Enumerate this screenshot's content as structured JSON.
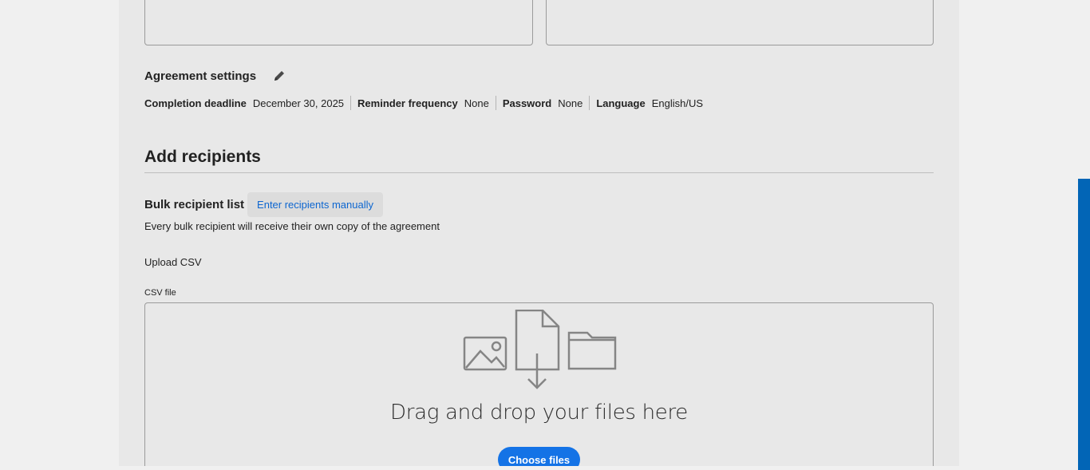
{
  "agreement_settings": {
    "title": "Agreement settings",
    "items": [
      {
        "key": "Completion deadline",
        "value": "December 30, 2025"
      },
      {
        "key": "Reminder frequency",
        "value": "None"
      },
      {
        "key": "Password",
        "value": "None"
      },
      {
        "key": "Language",
        "value": "English/US"
      }
    ]
  },
  "recipients": {
    "title": "Add recipients",
    "bulk_label": "Bulk recipient list",
    "manual_button": "Enter recipients manually",
    "description": "Every bulk recipient will receive their own copy of the agreement",
    "upload_label": "Upload CSV",
    "csv_label": "CSV file"
  },
  "dropzone": {
    "text": "Drag and drop your files here",
    "button": "Choose files"
  },
  "colors": {
    "accent": "#1473e6",
    "link": "#0d66d0",
    "side_strip": "#0265b6"
  },
  "icons": [
    "pencil-icon",
    "image-icon",
    "document-download-icon",
    "folder-icon"
  ]
}
